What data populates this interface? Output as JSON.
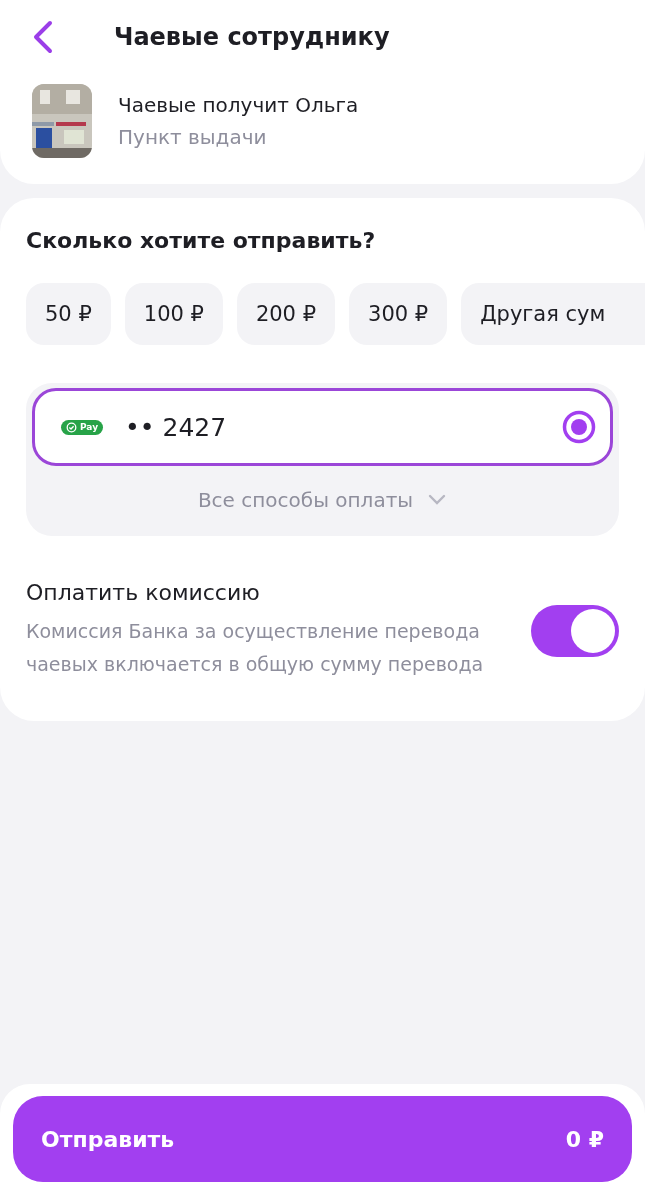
{
  "header": {
    "title": "Чаевые сотруднику"
  },
  "recipient": {
    "title": "Чаевые получит Ольга",
    "subtitle": "Пункт выдачи"
  },
  "amount": {
    "heading": "Сколько хотите отправить?",
    "options": [
      {
        "label": "50 ₽",
        "selected": false
      },
      {
        "label": "100 ₽",
        "selected": false
      },
      {
        "label": "200 ₽",
        "selected": false
      },
      {
        "label": "300 ₽",
        "selected": false
      },
      {
        "label": "Другая сум",
        "selected": false
      }
    ]
  },
  "payment": {
    "badge": "Pay",
    "card": "•• 2427",
    "selected": true,
    "all_methods": "Все способы оплаты"
  },
  "commission": {
    "title": "Оплатить комиссию",
    "description": "Комиссия Банка за осуществление перевода чаевых включается в общую сумму перевода",
    "on": true
  },
  "submit": {
    "label": "Отправить",
    "total": "0 ₽"
  }
}
